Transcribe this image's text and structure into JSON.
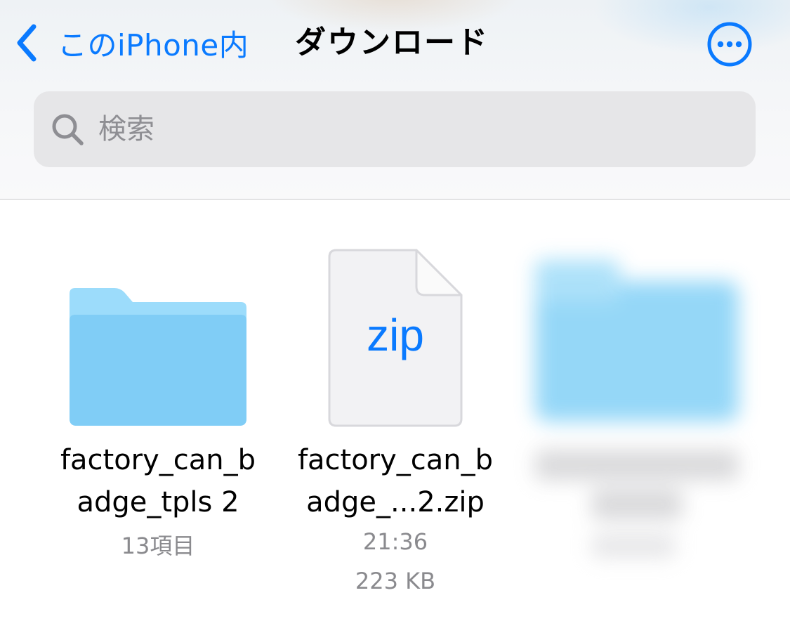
{
  "nav": {
    "back_label": "このiPhone内",
    "title": "ダウンロード",
    "back_icon": "chevron-left-icon",
    "more_icon": "ellipsis-circle-icon",
    "accent_color": "#0a7aff"
  },
  "search": {
    "placeholder": "検索",
    "value": "",
    "icon": "search-icon"
  },
  "files": [
    {
      "name": "factory_can_badge_tpls 2",
      "name_line1": "factory_can_b",
      "name_line2": "adge_tpls 2",
      "meta": [
        "13項目"
      ],
      "kind": "folder",
      "icon": "folder-icon",
      "icon_color": "#7fcdf5"
    },
    {
      "name_line1": "factory_can_b",
      "name_line2": "adge_...2.zip",
      "meta": [
        "21:36",
        "223 KB"
      ],
      "kind": "zip",
      "icon": "zip-file-icon",
      "icon_label": "zip",
      "icon_label_color": "#0a7aff"
    },
    {
      "kind": "folder",
      "icon": "folder-icon",
      "blurred": true
    }
  ]
}
